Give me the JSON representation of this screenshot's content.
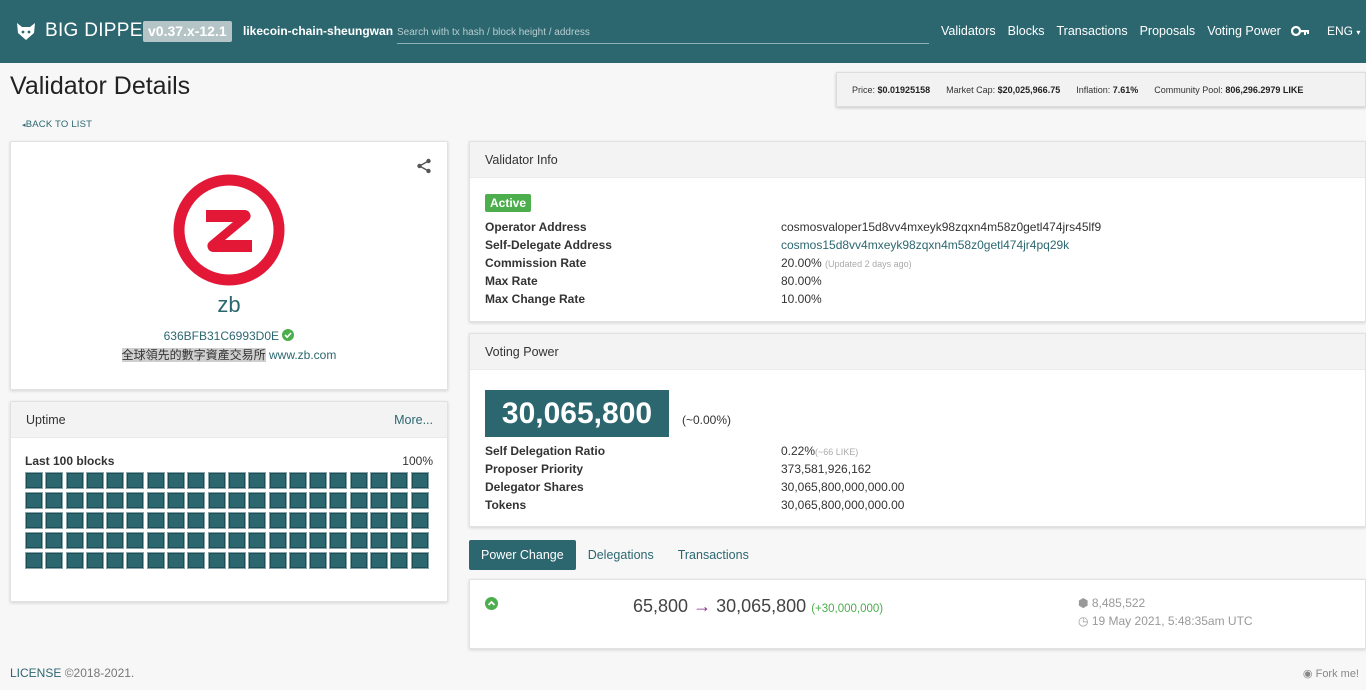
{
  "navbar": {
    "brand": "BIG DIPPER",
    "version": "v0.37.x-12.1",
    "chain": "likecoin-chain-sheungwan",
    "search_placeholder": "Search with tx hash / block height / address",
    "links": [
      "Validators",
      "Blocks",
      "Transactions",
      "Proposals",
      "Voting Power"
    ],
    "language": "ENG"
  },
  "page": {
    "title": "Validator Details",
    "back_label": "BACK TO LIST"
  },
  "stats": {
    "price_label": "Price:",
    "price": "$0.01925158",
    "market_cap_label": "Market Cap:",
    "market_cap": "$20,025,966.75",
    "inflation_label": "Inflation:",
    "inflation": "7.61%",
    "pool_label": "Community Pool:",
    "pool": "806,296.2979 LIKE"
  },
  "profile": {
    "moniker": "zb",
    "address": "636BFB31C6993D0E",
    "description_cjk": "全球領先的數字資產交易所",
    "description_site": "www.zb.com"
  },
  "uptime": {
    "title": "Uptime",
    "more": "More...",
    "blocks_label": "Last 100 blocks",
    "percent": "100%",
    "block_count": 100
  },
  "validator_info": {
    "title": "Validator Info",
    "status": "Active",
    "operator_label": "Operator Address",
    "operator": "cosmosvaloper15d8vv4mxeyk98zqxn4m58z0getl474jrs45lf9",
    "self_del_label": "Self-Delegate Address",
    "self_del": "cosmos15d8vv4mxeyk98zqxn4m58z0getl474jr4pq29k",
    "commission_label": "Commission Rate",
    "commission": "20.00%",
    "commission_note": "(Updated 2 days ago)",
    "max_rate_label": "Max Rate",
    "max_rate": "80.00%",
    "max_change_label": "Max Change Rate",
    "max_change": "10.00%"
  },
  "voting_power": {
    "title": "Voting Power",
    "value": "30,065,800",
    "percent": "(~0.00%)",
    "ratio_label": "Self Delegation Ratio",
    "ratio": "0.22%",
    "ratio_note": "(~66 LIKE)",
    "priority_label": "Proposer Priority",
    "priority": "373,581,926,162",
    "shares_label": "Delegator Shares",
    "shares": "30,065,800,000,000.00",
    "tokens_label": "Tokens",
    "tokens": "30,065,800,000,000.00"
  },
  "tabs": [
    "Power Change",
    "Delegations",
    "Transactions"
  ],
  "power_change": {
    "from": "65,800",
    "arrow": "→",
    "to": "30,065,800",
    "diff": "(+30,000,000)",
    "height": "8,485,522",
    "time": "19 May 2021, 5:48:35am UTC"
  },
  "footer": {
    "license": "LICENSE",
    "copyright": "©2018-2021.",
    "fork": "Fork me!"
  },
  "colors": {
    "primary": "#2c6770",
    "success": "#4cae4c",
    "accent_logo": "#e31837"
  }
}
